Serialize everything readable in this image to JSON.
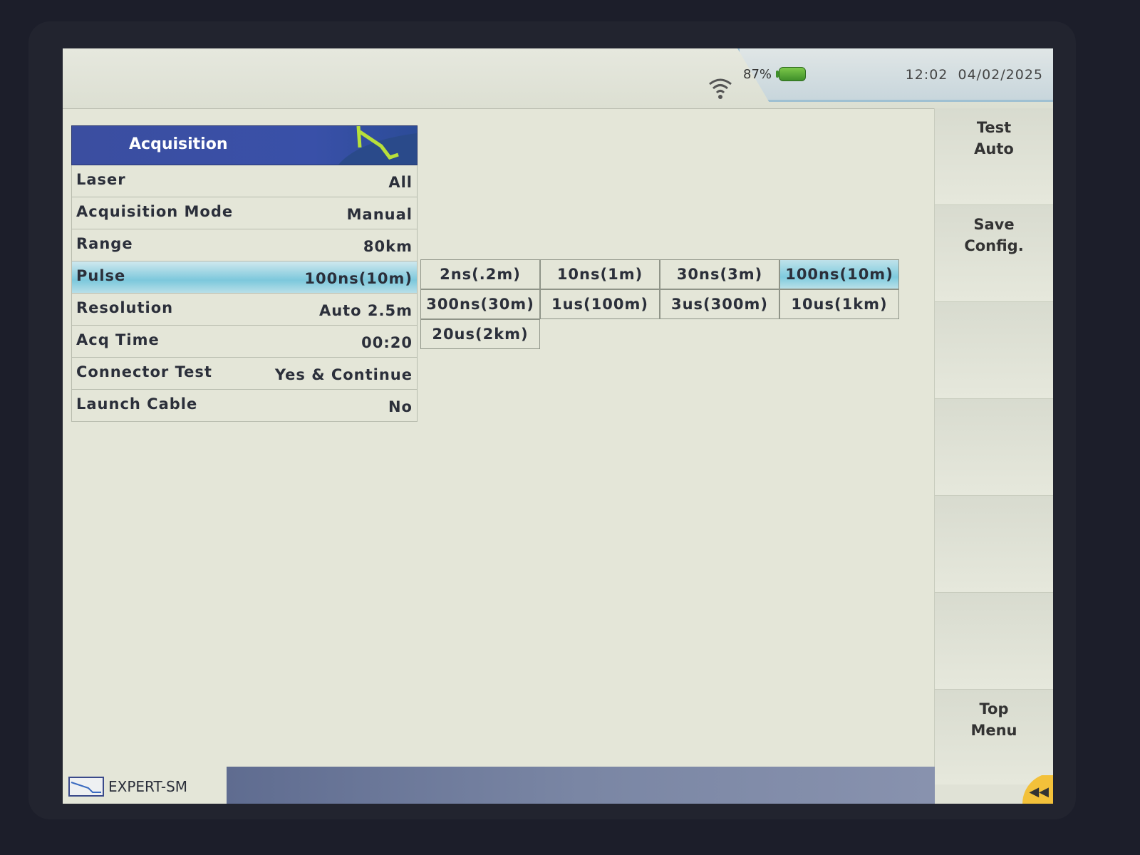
{
  "status": {
    "battery_pct": "87%",
    "time": "12:02",
    "date": "04/02/2025"
  },
  "panel": {
    "title": "Acquisition",
    "rows": [
      {
        "label": "Laser",
        "value": "All"
      },
      {
        "label": "Acquisition Mode",
        "value": "Manual"
      },
      {
        "label": "Range",
        "value": "80km"
      },
      {
        "label": "Pulse",
        "value": "100ns(10m)"
      },
      {
        "label": "Resolution",
        "value": "Auto 2.5m"
      },
      {
        "label": "Acq Time",
        "value": "00:20"
      },
      {
        "label": "Connector Test",
        "value": "Yes & Continue"
      },
      {
        "label": "Launch Cable",
        "value": "No"
      }
    ]
  },
  "pulse_options": [
    "2ns(.2m)",
    "10ns(1m)",
    "30ns(3m)",
    "100ns(10m)",
    "300ns(30m)",
    "1us(100m)",
    "3us(300m)",
    "10us(1km)",
    "20us(2km)"
  ],
  "softkeys": {
    "k1": "Test\nAuto",
    "k2": "Save\nConfig.",
    "k7": "Top\nMenu"
  },
  "bottom": {
    "module": "EXPERT-SM"
  },
  "colors": {
    "header_blue": "#3b4ea0",
    "selection_cyan": "#7cc8dc",
    "battery_green": "#3f8f2a"
  }
}
